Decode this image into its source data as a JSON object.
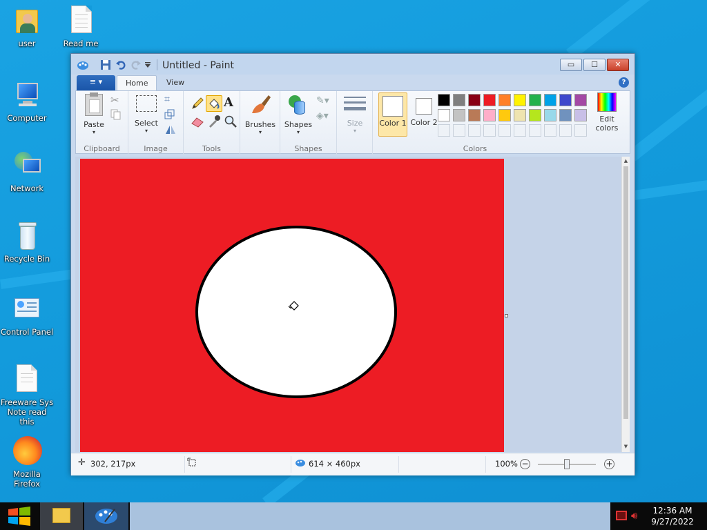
{
  "desktop": {
    "icons": [
      {
        "label": "user",
        "icon": "user-folder-icon"
      },
      {
        "label": "Read me",
        "icon": "text-document-icon"
      },
      {
        "label": "Computer",
        "icon": "computer-icon"
      },
      {
        "label": "Network",
        "icon": "network-icon"
      },
      {
        "label": "Recycle Bin",
        "icon": "recycle-bin-icon"
      },
      {
        "label": "Control Panel",
        "icon": "control-panel-icon"
      },
      {
        "label": "Freeware Sys Note read this",
        "icon": "text-document-icon"
      },
      {
        "label": "Mozilla Firefox",
        "icon": "firefox-icon"
      }
    ]
  },
  "window": {
    "title": "Untitled - Paint",
    "controls": {
      "minimize": "▭",
      "maximize": "☐",
      "close": "✕"
    }
  },
  "ribbon": {
    "file_tab": "≡ ▾",
    "tabs": [
      "Home",
      "View"
    ],
    "groups": {
      "clipboard": {
        "label": "Clipboard",
        "paste": "Paste"
      },
      "image": {
        "label": "Image",
        "select": "Select"
      },
      "tools": {
        "label": "Tools"
      },
      "brushes": {
        "label": "Brushes"
      },
      "shapes": {
        "label": "Shapes",
        "button": "Shapes"
      },
      "size": {
        "label": "Size"
      },
      "colors": {
        "label": "Colors",
        "color1": "Color 1",
        "color2": "Color 2",
        "edit": "Edit colors",
        "palette_row1": [
          "#000000",
          "#7f7f7f",
          "#880015",
          "#ed1c24",
          "#ff7f27",
          "#fff200",
          "#22b14c",
          "#00a2e8",
          "#3f48cc",
          "#a349a4"
        ],
        "palette_row2": [
          "#ffffff",
          "#c3c3c3",
          "#b97a57",
          "#ffaec9",
          "#ffc90e",
          "#efe4b0",
          "#b5e61d",
          "#99d9ea",
          "#7092be",
          "#c8bfe7"
        ]
      }
    }
  },
  "canvas": {
    "background": "#ed1c24",
    "ellipse_fill": "#ffffff",
    "ellipse_stroke": "#000000"
  },
  "status": {
    "cursor_pos": "302, 217px",
    "canvas_size": "614 × 460px",
    "zoom": "100%"
  },
  "taskbar": {
    "time": "12:36 AM",
    "date": "9/27/2022"
  }
}
